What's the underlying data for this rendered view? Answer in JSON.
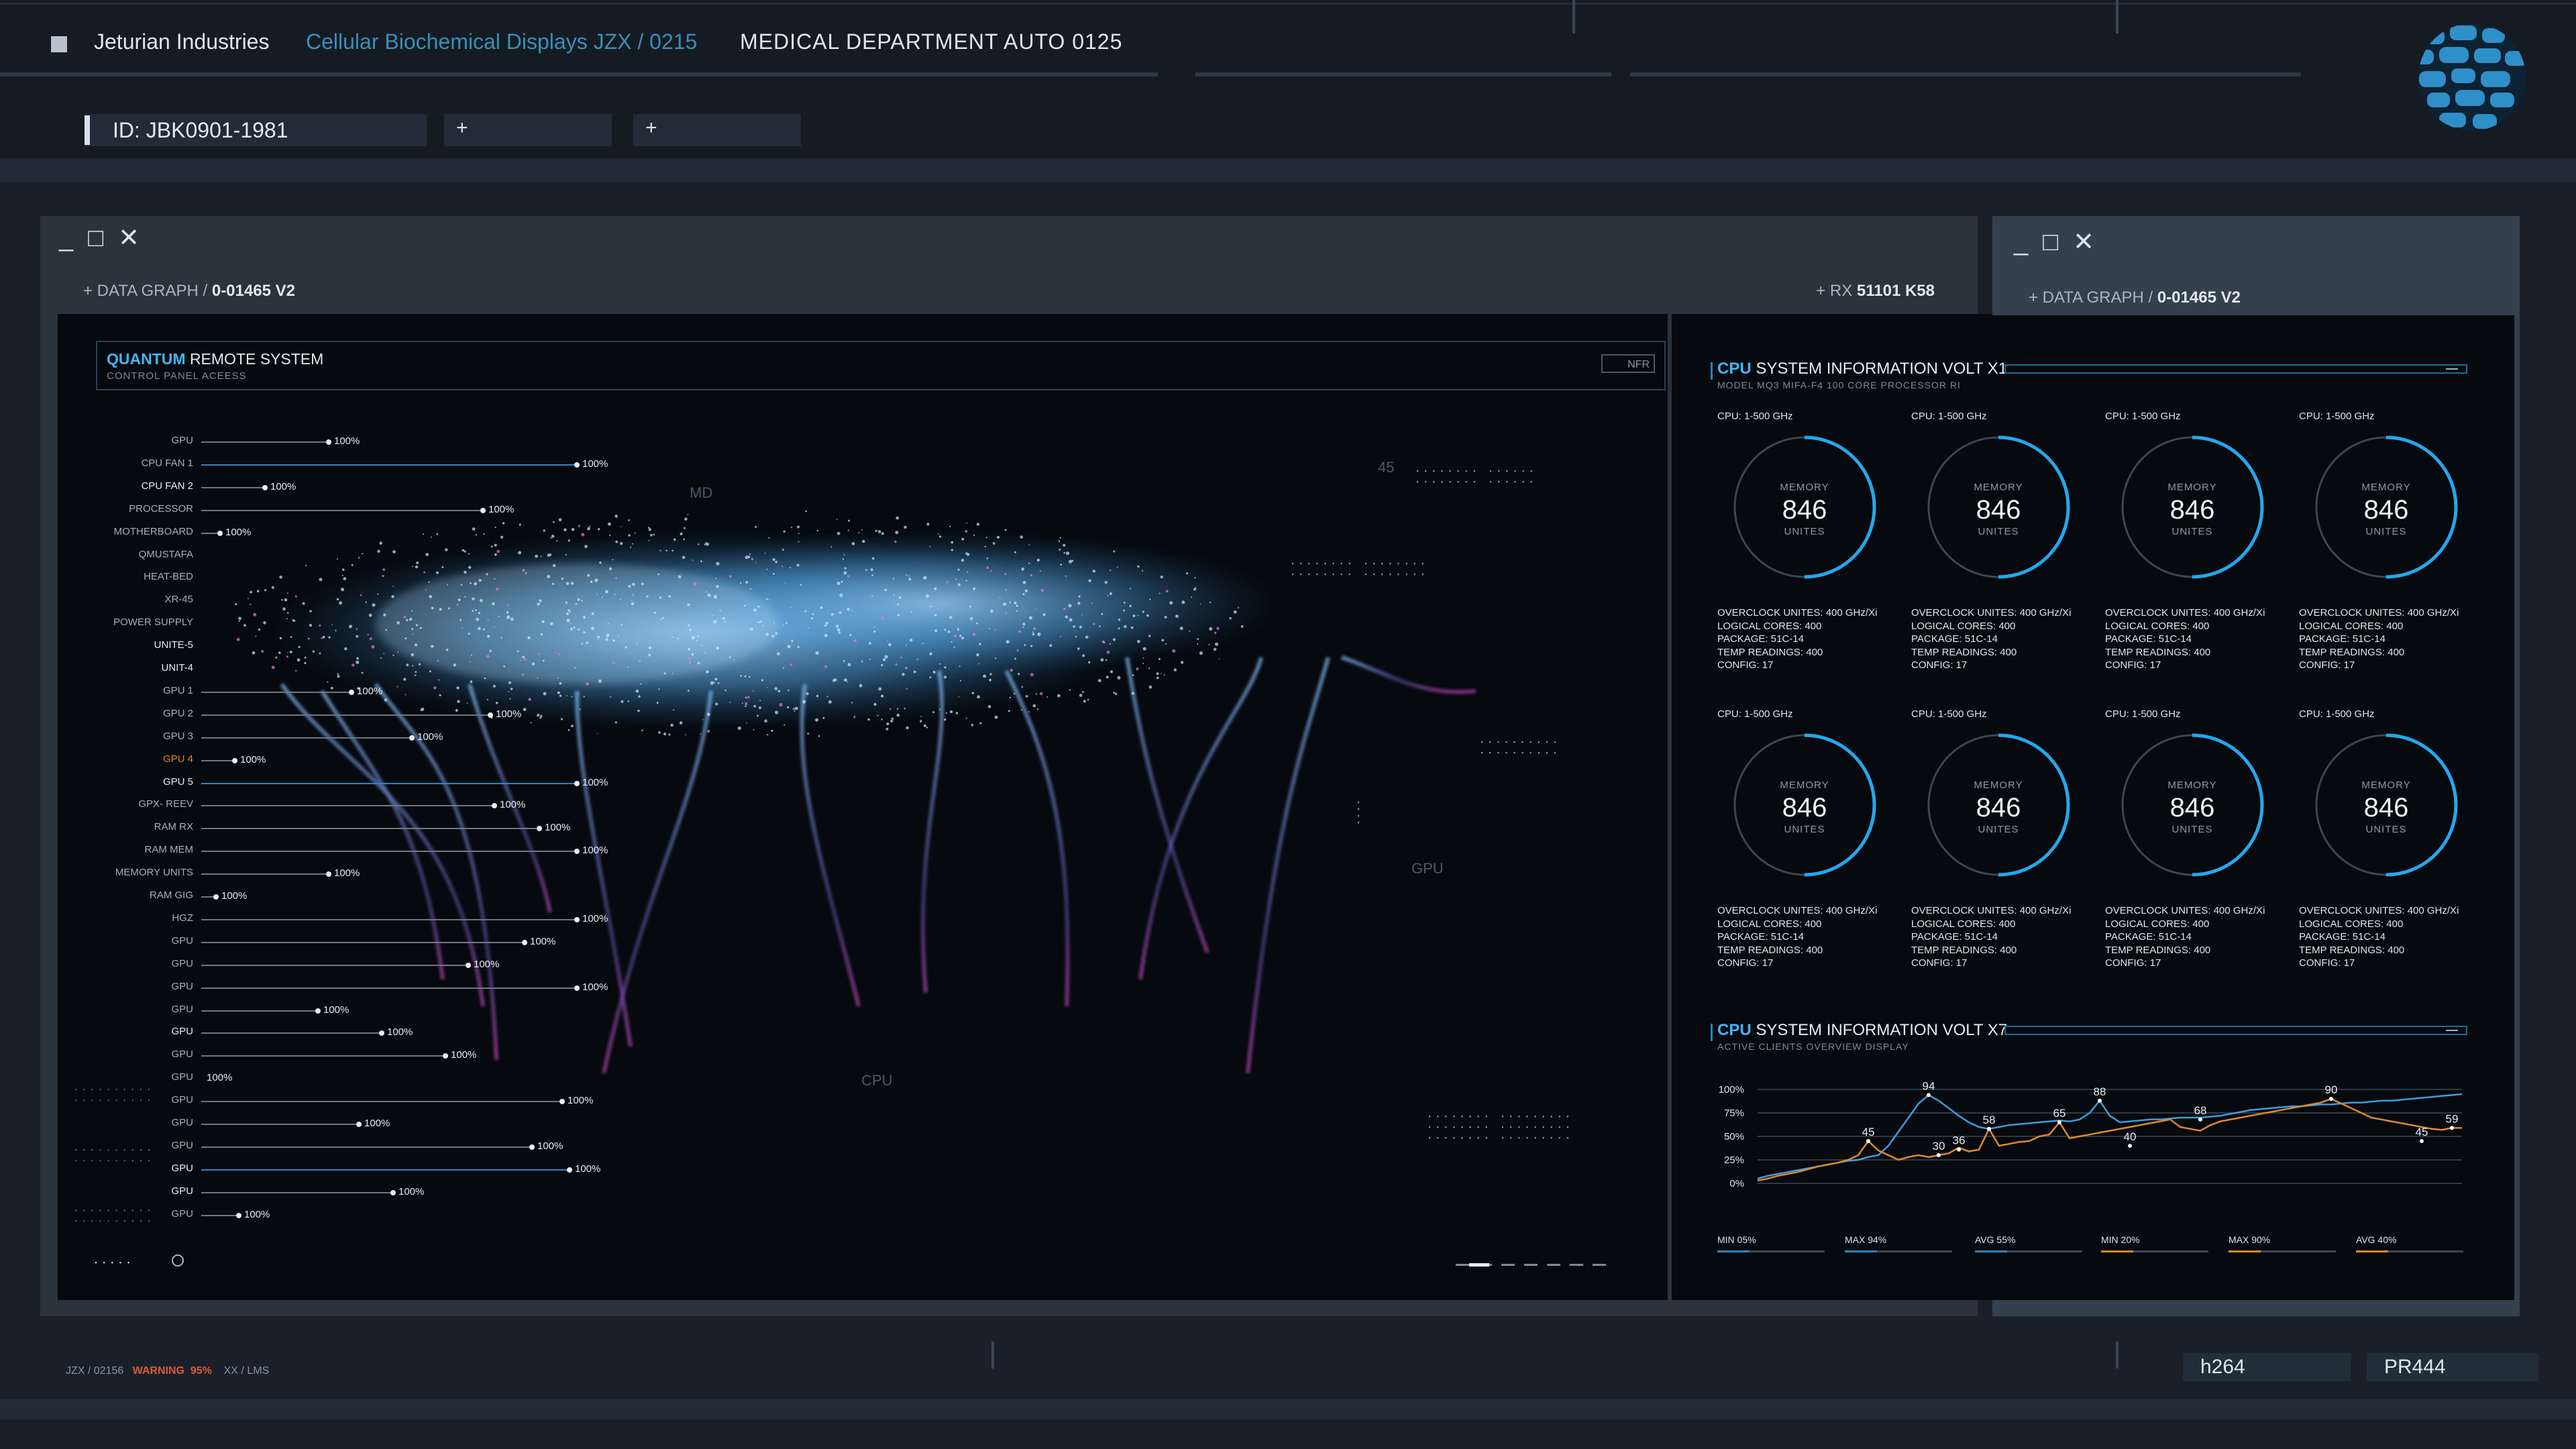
{
  "top_bar": {
    "company": "Jeturian Industries",
    "product": "Cellular Biochemical Displays JZX / 0215",
    "department": "MEDICAL DEPARTMENT AUTO 0125",
    "id_field": "ID: JBK0901-1981",
    "add_tab_1": "+",
    "add_tab_2": "+"
  },
  "main_window": {
    "controls": [
      "_",
      "□",
      "✕"
    ],
    "head_prefix": "+ DATA GRAPH",
    "head_sep": "/",
    "head_id": "0-01465 V2",
    "head_right_prefix": "+ RX",
    "head_right_id": "51101 K58",
    "quantum": {
      "title_accent": "QUANTUM",
      "title_rest": "REMOTE SYSTEM",
      "subtitle": "CONTROL PANEL ACEESS",
      "badge": "NFR"
    },
    "labels": [
      {
        "name": "GPU",
        "pct": "100%",
        "len": 0.34
      },
      {
        "name": "CPU FAN 1",
        "pct": "100%",
        "len": 1.0,
        "blue": true
      },
      {
        "name": "CPU FAN 2",
        "pct": "100%",
        "len": 0.17,
        "hi": true
      },
      {
        "name": "PROCESSOR",
        "pct": "100%",
        "len": 0.75
      },
      {
        "name": "MOTHERBOARD",
        "pct": "100%",
        "len": 0.05
      },
      {
        "name": "QMUSTAFA",
        "pct": "",
        "len": 0.0
      },
      {
        "name": "HEAT-BED",
        "pct": "",
        "len": 0.0
      },
      {
        "name": "XR-45",
        "pct": "",
        "len": 0.0
      },
      {
        "name": "POWER SUPPLY",
        "pct": "",
        "len": 0.0
      },
      {
        "name": "UNITE-5",
        "pct": "",
        "len": 0.0,
        "hi": true
      },
      {
        "name": "UNIT-4",
        "pct": "",
        "len": 0.0,
        "hi": true
      },
      {
        "name": "GPU 1",
        "pct": "100%",
        "len": 0.4
      },
      {
        "name": "GPU 2",
        "pct": "100%",
        "len": 0.77
      },
      {
        "name": "GPU 3",
        "pct": "100%",
        "len": 0.56
      },
      {
        "name": "GPU 4",
        "pct": "100%",
        "len": 0.09,
        "warn": true
      },
      {
        "name": "GPU 5",
        "pct": "100%",
        "len": 1.0,
        "hi": true,
        "blue": true
      },
      {
        "name": "GPX- REEV",
        "pct": "100%",
        "len": 0.78
      },
      {
        "name": "RAM RX",
        "pct": "100%",
        "len": 0.9
      },
      {
        "name": "RAM MEM",
        "pct": "100%",
        "len": 1.0
      },
      {
        "name": "MEMORY UNITS",
        "pct": "100%",
        "len": 0.34
      },
      {
        "name": "RAM GIG",
        "pct": "100%",
        "len": 0.04
      },
      {
        "name": "HGZ",
        "pct": "100%",
        "len": 1.0
      },
      {
        "name": "GPU",
        "pct": "100%",
        "len": 0.86
      },
      {
        "name": "GPU",
        "pct": "100%",
        "len": 0.71
      },
      {
        "name": "GPU",
        "pct": "100%",
        "len": 1.0
      },
      {
        "name": "GPU",
        "pct": "100%",
        "len": 0.31
      },
      {
        "name": "GPU",
        "pct": "100%",
        "len": 0.48,
        "hi": true
      },
      {
        "name": "GPU",
        "pct": "100%",
        "len": 0.65
      },
      {
        "name": "GPU",
        "pct": "100%",
        "len": 0.0
      },
      {
        "name": "GPU",
        "pct": "100%",
        "len": 0.96
      },
      {
        "name": "GPU",
        "pct": "100%",
        "len": 0.42
      },
      {
        "name": "GPU",
        "pct": "100%",
        "len": 0.88
      },
      {
        "name": "GPU",
        "pct": "100%",
        "len": 0.98,
        "blue": true,
        "hi": true
      },
      {
        "name": "GPU",
        "pct": "100%",
        "len": 0.51,
        "hi": true
      },
      {
        "name": "GPU",
        "pct": "100%",
        "len": 0.1
      }
    ],
    "ghost_labels": [
      "45",
      "MD",
      "GPU",
      "CPU"
    ]
  },
  "side_window": {
    "controls": [
      "_",
      "□",
      "✕"
    ],
    "head_prefix": "+ DATA GRAPH",
    "head_sep": "/",
    "head_id": "0-01465 V2"
  },
  "cpu_info": {
    "title_accent": "CPU",
    "title_rest": "SYSTEM INFORMATION VOLT X1",
    "subtitle": "MODEL MQ3 MIFA-F4 100 CORE PROCESSOR RI",
    "gauges": [
      {
        "clock": "CPU: 1-500 GHz",
        "mem_label": "MEMORY",
        "value": "846",
        "unit": "UNITES",
        "level": 0.5
      },
      {
        "clock": "CPU: 1-500 GHz",
        "mem_label": "MEMORY",
        "value": "846",
        "unit": "UNITES",
        "level": 0.5
      },
      {
        "clock": "CPU: 1-500 GHz",
        "mem_label": "MEMORY",
        "value": "846",
        "unit": "UNITES",
        "level": 0.5
      },
      {
        "clock": "CPU: 1-500 GHz",
        "mem_label": "MEMORY",
        "value": "846",
        "unit": "UNITES",
        "level": 0.5
      },
      {
        "clock": "CPU: 1-500 GHz",
        "mem_label": "MEMORY",
        "value": "846",
        "unit": "UNITES",
        "level": 0.5
      },
      {
        "clock": "CPU: 1-500 GHz",
        "mem_label": "MEMORY",
        "value": "846",
        "unit": "UNITES",
        "level": 0.5
      },
      {
        "clock": "CPU: 1-500 GHz",
        "mem_label": "MEMORY",
        "value": "846",
        "unit": "UNITES",
        "level": 0.5
      },
      {
        "clock": "CPU: 1-500 GHz",
        "mem_label": "MEMORY",
        "value": "846",
        "unit": "UNITES",
        "level": 0.5
      }
    ],
    "spec_lines": [
      "OVERCLOCK UNITES: 400 GHz/Xi",
      "LOGICAL CORES: 400",
      "PACKAGE: 51C-14",
      "TEMP READINGS: 400",
      "CONFIG: 17"
    ]
  },
  "cpu_clients": {
    "title_accent": "CPU",
    "title_rest": "SYSTEM INFORMATION VOLT X7",
    "subtitle": "ACTIVE CLIENTS OVERVIEW DISPLAY",
    "stats": [
      "MIN 05%",
      "MAX 94%",
      "AVG 55%",
      "MIN 20%",
      "MAX 90%",
      "AVG 40%"
    ]
  },
  "chart_data": {
    "type": "line",
    "x": [
      0,
      1,
      2,
      3,
      4,
      5,
      6,
      7,
      8,
      9,
      10,
      11,
      12,
      13,
      14,
      15,
      16,
      17,
      18,
      19,
      20,
      21,
      22,
      23,
      24,
      25,
      26,
      27,
      28,
      29,
      30,
      31,
      32,
      33,
      34,
      35,
      36,
      37,
      38,
      39,
      40,
      41,
      42,
      43,
      44,
      45,
      46,
      47,
      48,
      49,
      50,
      51,
      52,
      53,
      54,
      55,
      56,
      57,
      58,
      59,
      60,
      61,
      62,
      63,
      64,
      65,
      66,
      67,
      68,
      69,
      70
    ],
    "yticks": [
      "100%",
      "75%",
      "50%",
      "25%",
      "0%"
    ],
    "ylim": [
      0,
      100
    ],
    "series": [
      {
        "color": "#3a9fe0",
        "values": [
          5,
          8,
          10,
          12,
          14,
          16,
          18,
          20,
          22,
          24,
          25,
          28,
          30,
          40,
          55,
          70,
          85,
          94,
          88,
          80,
          72,
          65,
          60,
          58,
          60,
          62,
          63,
          64,
          65,
          66,
          67,
          66,
          68,
          75,
          88,
          72,
          65,
          66,
          67,
          68,
          68,
          69,
          70,
          70,
          70,
          71,
          72,
          74,
          76,
          78,
          79,
          80,
          81,
          82,
          82,
          83,
          84,
          84,
          85,
          86,
          86,
          87,
          88,
          88,
          89,
          90,
          91,
          92,
          93,
          94,
          95
        ]
      },
      {
        "color": "#e08a2a",
        "values": [
          3,
          5,
          8,
          10,
          12,
          15,
          18,
          20,
          22,
          25,
          30,
          45,
          35,
          30,
          25,
          28,
          30,
          28,
          30,
          32,
          38,
          34,
          36,
          58,
          40,
          42,
          44,
          45,
          50,
          52,
          65,
          48,
          50,
          52,
          54,
          56,
          58,
          60,
          62,
          64,
          66,
          68,
          60,
          58,
          56,
          62,
          66,
          68,
          70,
          72,
          74,
          76,
          78,
          80,
          82,
          84,
          86,
          90,
          85,
          80,
          75,
          70,
          68,
          66,
          64,
          62,
          60,
          58,
          57,
          59,
          59
        ]
      }
    ],
    "data_labels": [
      {
        "x": 11,
        "y": 45,
        "text": "45"
      },
      {
        "x": 17,
        "y": 94,
        "text": "94"
      },
      {
        "x": 18,
        "y": 30,
        "text": "30"
      },
      {
        "x": 20,
        "y": 36,
        "text": "36"
      },
      {
        "x": 23,
        "y": 58,
        "text": "58"
      },
      {
        "x": 30,
        "y": 65,
        "text": "65"
      },
      {
        "x": 34,
        "y": 88,
        "text": "88"
      },
      {
        "x": 37,
        "y": 40,
        "text": "40"
      },
      {
        "x": 44,
        "y": 68,
        "text": "68"
      },
      {
        "x": 57,
        "y": 90,
        "text": "90"
      },
      {
        "x": 66,
        "y": 45,
        "text": "45"
      },
      {
        "x": 69,
        "y": 59,
        "text": "59"
      }
    ]
  },
  "footer": {
    "code": "JZX / 02156",
    "warning": "WARNING",
    "warning_pct": "95%",
    "tail": "XX / LMS",
    "box_1": "h264",
    "box_2": "PR444"
  }
}
